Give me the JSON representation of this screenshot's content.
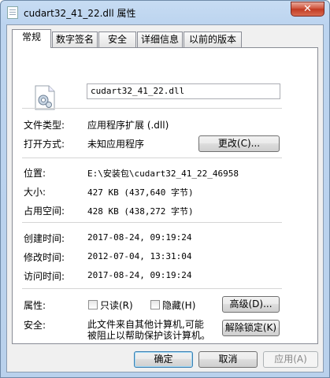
{
  "window": {
    "title": "cudart32_41_22.dll 属性",
    "close_label": "✕"
  },
  "tabs": [
    {
      "label": "常规"
    },
    {
      "label": "数字签名"
    },
    {
      "label": "安全"
    },
    {
      "label": "详细信息"
    },
    {
      "label": "以前的版本"
    }
  ],
  "general": {
    "file_name": "cudart32_41_22.dll",
    "file_type_label": "文件类型:",
    "file_type_value": "应用程序扩展 (.dll)",
    "opens_with_label": "打开方式:",
    "opens_with_value": "未知应用程序",
    "change_button": "更改(C)...",
    "location_label": "位置:",
    "location_value": "E:\\安装包\\cudart32_41_22_46958",
    "size_label": "大小:",
    "size_value": "427 KB (437,640 字节)",
    "disk_size_label": "占用空间:",
    "disk_size_value": "428 KB (438,272 字节)",
    "created_label": "创建时间:",
    "created_value": "2017-08-24, 09:19:24",
    "modified_label": "修改时间:",
    "modified_value": "2012-07-04, 13:31:04",
    "accessed_label": "访问时间:",
    "accessed_value": "2017-08-24, 09:19:24",
    "attributes_label": "属性:",
    "readonly_label": "只读(R)",
    "hidden_label": "隐藏(H)",
    "advanced_button": "高级(D)...",
    "security_label": "安全:",
    "security_text_line1": "此文件来自其他计算机,可能",
    "security_text_line2": "被阻止以帮助保护该计算机。",
    "unblock_button": "解除锁定(K)"
  },
  "footer": {
    "ok": "确定",
    "cancel": "取消",
    "apply": "应用(A)"
  }
}
